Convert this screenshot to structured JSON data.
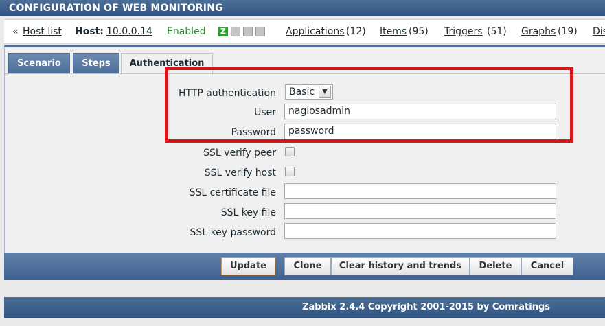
{
  "header": {
    "title": "CONFIGURATION OF WEB MONITORING"
  },
  "hostbar": {
    "back_prefix": "«",
    "host_list": "Host list",
    "host_label": "Host:",
    "host_value": "10.0.0.14",
    "status": "Enabled",
    "applications": "Applications",
    "applications_count": "(12)",
    "items": "Items",
    "items_count": "(95)",
    "triggers": "Triggers",
    "triggers_count": "(51)",
    "graphs": "Graphs",
    "graphs_count": "(19)",
    "discovery": "Dis",
    "availability_icons": [
      {
        "name": "zabbix-agent-icon",
        "letter": "Z",
        "color": "#2ca02c"
      },
      {
        "name": "snmp-icon",
        "letter": "▦",
        "color": "#b0b0b0"
      },
      {
        "name": "jmx-icon",
        "letter": "▦",
        "color": "#b0b0b0"
      },
      {
        "name": "ipmi-icon",
        "letter": "▦",
        "color": "#b0b0b0"
      }
    ]
  },
  "tabs": {
    "scenario": "Scenario",
    "steps": "Steps",
    "authentication": "Authentication"
  },
  "form": {
    "http_auth_label": "HTTP authentication",
    "http_auth_value": "Basic",
    "user_label": "User",
    "user_value": "nagiosadmin",
    "password_label": "Password",
    "password_value": "password",
    "ssl_verify_peer_label": "SSL verify peer",
    "ssl_verify_host_label": "SSL verify host",
    "ssl_cert_file_label": "SSL certificate file",
    "ssl_cert_file_value": "",
    "ssl_key_file_label": "SSL key file",
    "ssl_key_file_value": "",
    "ssl_key_password_label": "SSL key password",
    "ssl_key_password_value": ""
  },
  "buttons": {
    "update": "Update",
    "clone": "Clone",
    "clear_history": "Clear history and trends",
    "delete": "Delete",
    "cancel": "Cancel"
  },
  "footer": {
    "text": "Zabbix 2.4.4 Copyright 2001-2015 by Comratings"
  },
  "colors": {
    "header": "#2f5481",
    "highlight": "#d9161c",
    "enabled": "#209320"
  }
}
